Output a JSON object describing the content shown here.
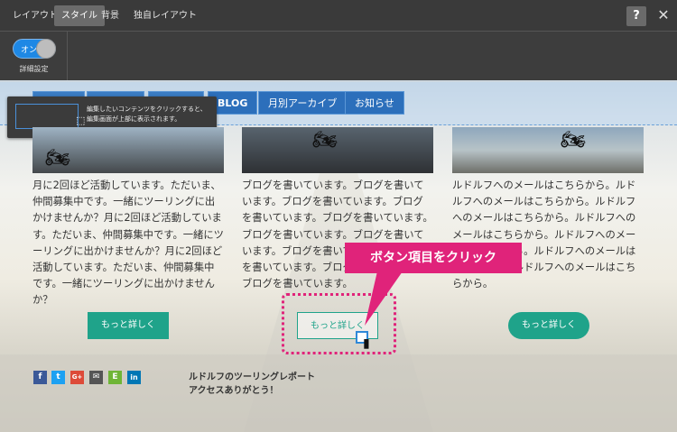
{
  "topbar": {
    "tabs": [
      "レイアウト",
      "スタイル",
      "背景",
      "独自レイアウト"
    ],
    "help_label": "?",
    "close_label": "✕"
  },
  "subbar": {
    "toggle_label": "オン",
    "setting_label": "詳細設定"
  },
  "nav": {
    "items": [
      "BLOG",
      "月別アーカイブ",
      "お知らせ"
    ]
  },
  "tooltip": {
    "line1": "編集したいコンテンツをクリックすると、",
    "line2": "編集画面が上部に表示されます。"
  },
  "columns": [
    {
      "text": "月に2回ほど活動しています。ただいま、仲間募集中です。一緒にツーリングに出かけませんか？月に2回ほど活動しています。ただいま、仲間募集中です。一緒にツーリングに出かけませんか？月に2回ほど活動しています。ただいま、仲間募集中です。一緒にツーリングに出かけませんか？",
      "button": "もっと詳しく"
    },
    {
      "text": "ブログを書いています。ブログを書いています。ブログを書いています。ブログを書いています。ブログを書いています。ブログを書いています。ブログを書いています。ブログを書いています。ブログを書いています。ブログを書いています。ブログを書いています。",
      "button": "もっと詳しく"
    },
    {
      "text": "ルドルフへのメールはこちらから。ルドルフへのメールはこちらから。ルドルフへのメールはこちらから。ルドルフへのメールはこちらから。ルドルフへのメールはこちらから。ルドルフへのメールはこちらから。ルドルフへのメールはこちらから。",
      "button": "もっと詳しく"
    }
  ],
  "callout": "ボタン項目をクリック",
  "footer": {
    "line1": "ルドルフのツーリングレポート",
    "line2": "アクセスありがとう！",
    "social": [
      {
        "icon": "facebook-icon",
        "glyph": "f",
        "color": "#3b5998"
      },
      {
        "icon": "twitter-icon",
        "glyph": "t",
        "color": "#1da1f2"
      },
      {
        "icon": "google-plus-icon",
        "glyph": "G+",
        "color": "#dd4b39"
      },
      {
        "icon": "mail-icon",
        "glyph": "✉",
        "color": "#555555"
      },
      {
        "icon": "evernote-icon",
        "glyph": "E",
        "color": "#6fb536"
      },
      {
        "icon": "linkedin-icon",
        "glyph": "in",
        "color": "#0077b5"
      }
    ]
  }
}
